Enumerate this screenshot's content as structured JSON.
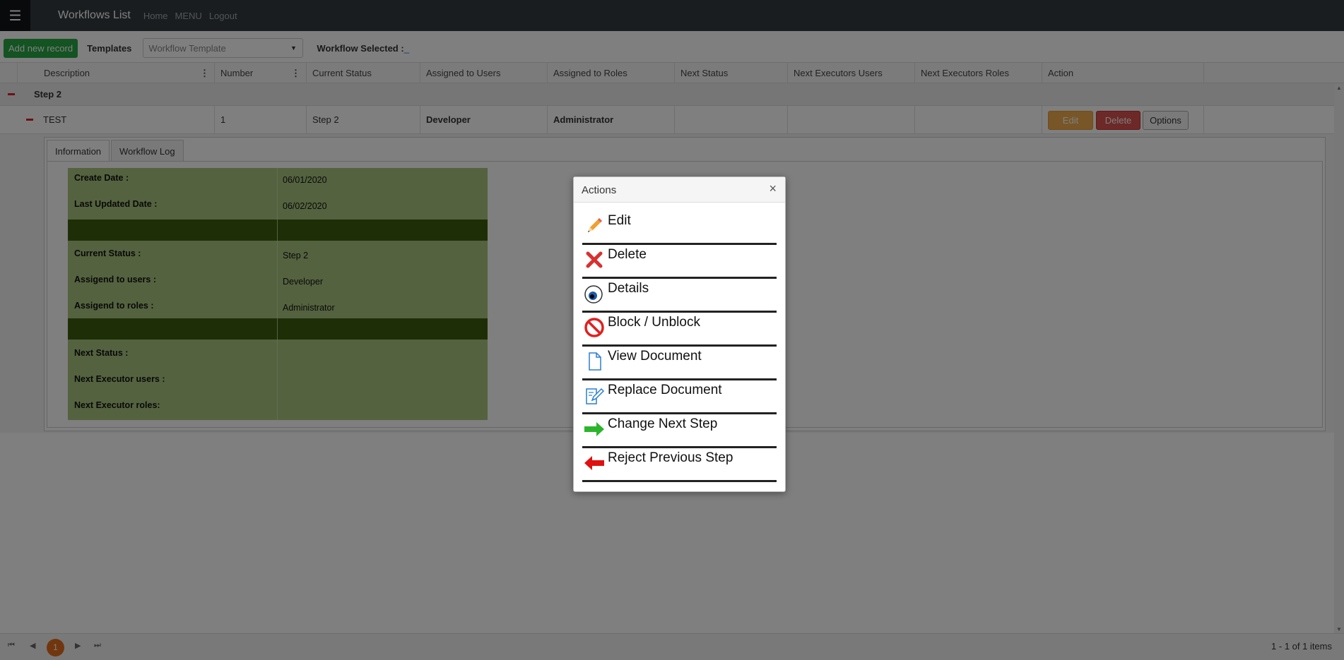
{
  "navbar": {
    "menu_icon": "hamburger-icon",
    "title": "Workflows List",
    "links": [
      "Home",
      "MENU",
      "Logout"
    ]
  },
  "toolbar": {
    "add_label": "Add new record",
    "templates_label": "Templates",
    "template_placeholder": "Workflow Template",
    "selected_label": "Workflow Selected :",
    "selected_value": "_"
  },
  "grid": {
    "columns": [
      "Description",
      "Number",
      "Current Status",
      "Assigned to Users",
      "Assigned to Roles",
      "Next Status",
      "Next Executors Users",
      "Next Executors Roles",
      "Action"
    ],
    "group_label": "Step 2",
    "row": {
      "description": "TEST",
      "number": "1",
      "current_status": "Step 2",
      "assigned_users": "Developer",
      "assigned_roles": "Administrator",
      "next_status": "",
      "next_exec_users": "",
      "next_exec_roles": "",
      "edit": "Edit",
      "delete": "Delete",
      "options": "Options"
    }
  },
  "detail": {
    "tabs": [
      "Information",
      "Workflow Log"
    ],
    "info": {
      "create_date_label": "Create Date :",
      "create_date": "06/01/2020",
      "updated_label": "Last Updated Date :",
      "updated": "06/02/2020",
      "current_status_label": "Current Status :",
      "current_status": "Step 2",
      "users_label": "Assigend to users :",
      "users": "Developer",
      "roles_label": "Assigend to roles :",
      "roles": "Administrator",
      "next_status_label": "Next Status :",
      "next_exec_users_label": "Next Executor users :",
      "next_exec_roles_label": "Next Executor roles:"
    },
    "colors": {
      "panel": "#a9c47f",
      "divider": "#3d5f0f"
    }
  },
  "pager": {
    "current_page": "1",
    "info": "1 - 1 of 1 items"
  },
  "modal": {
    "title": "Actions",
    "close": "×",
    "actions": [
      {
        "label": "Edit",
        "icon": "pencil-icon"
      },
      {
        "label": "Delete",
        "icon": "red-x-icon"
      },
      {
        "label": "Details",
        "icon": "eye-icon"
      },
      {
        "label": "Block / Unblock",
        "icon": "no-entry-icon"
      },
      {
        "label": "View Document",
        "icon": "document-icon"
      },
      {
        "label": "Replace Document",
        "icon": "edit-document-icon"
      },
      {
        "label": "Change Next Step",
        "icon": "green-arrow-right-icon"
      },
      {
        "label": "Reject Previous Step",
        "icon": "red-arrow-left-icon"
      }
    ]
  }
}
